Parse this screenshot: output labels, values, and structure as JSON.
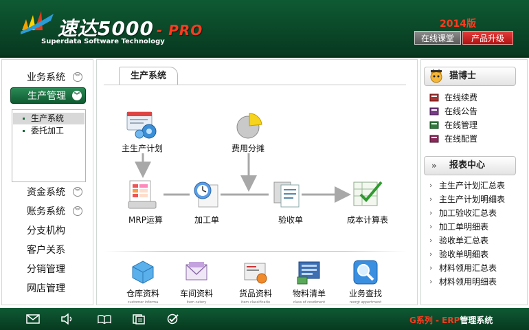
{
  "header": {
    "product_name": "速达5000",
    "pro_suffix": "- PRO",
    "subtitle": "Superdata Software Technology",
    "edition": "2014版",
    "online_class_label": "在线课堂",
    "upgrade_label": "产品升级"
  },
  "leftnav": {
    "items": [
      {
        "label": "业务系统"
      },
      {
        "label": "生产管理"
      },
      {
        "label": "资金系统"
      },
      {
        "label": "账务系统"
      },
      {
        "label": "分支机构"
      },
      {
        "label": "客户关系"
      },
      {
        "label": "分销管理"
      },
      {
        "label": "网店管理"
      }
    ],
    "subitems": [
      {
        "label": "生产系统"
      },
      {
        "label": "委托加工"
      }
    ]
  },
  "center": {
    "tab_label": "生产系统",
    "flow": {
      "master_plan": "主生产计划",
      "cost_allocation": "费用分摊",
      "mrp": "MRP运算",
      "process_order": "加工单",
      "receipt": "验收单",
      "cost_table": "成本计算表"
    },
    "bottom": [
      {
        "label": "仓库资料",
        "sub": "customer informa"
      },
      {
        "label": "车间资料",
        "sub": "item catery"
      },
      {
        "label": "货品资料",
        "sub": "item classificatio"
      },
      {
        "label": "物料清单",
        "sub": "class of cosdiment"
      },
      {
        "label": "业务查找",
        "sub": "reorgt appertment"
      }
    ]
  },
  "right": {
    "assistant_title": "猫博士",
    "assistant_items": [
      {
        "label": "在线续费"
      },
      {
        "label": "在线公告"
      },
      {
        "label": "在线管理"
      },
      {
        "label": "在线配置"
      }
    ],
    "reports_title": "报表中心",
    "reports": [
      {
        "label": "主生产计划汇总表"
      },
      {
        "label": "主生产计划明细表"
      },
      {
        "label": "加工验收汇总表"
      },
      {
        "label": "加工单明细表"
      },
      {
        "label": "验收单汇总表"
      },
      {
        "label": "验收单明细表"
      },
      {
        "label": "材料领用汇总表"
      },
      {
        "label": "材料领用明细表"
      }
    ]
  },
  "footer": {
    "series": "G系列 - ERP",
    "system": "管理系统"
  },
  "colors": {
    "header_green": "#0a4527",
    "accent_red": "#ff3b1f",
    "upgrade_red": "#c41f1f"
  }
}
